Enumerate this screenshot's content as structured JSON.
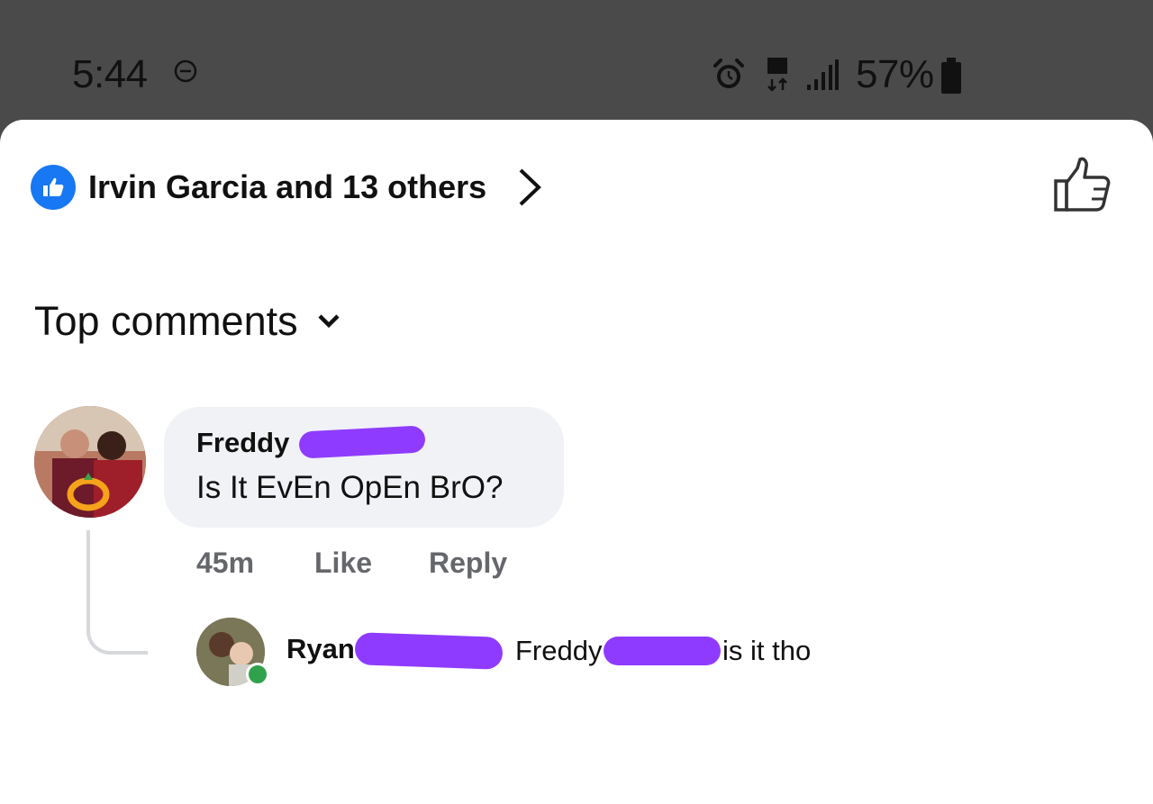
{
  "status_bar": {
    "time": "5:44",
    "battery": "57%",
    "icons": [
      "do-not-disturb-icon",
      "alarm-icon",
      "mobile-data-icon",
      "signal-icon",
      "battery-icon"
    ]
  },
  "reactions": {
    "summary": "Irvin Garcia and 13 others",
    "icon": "like-badge-icon",
    "accent": "#1877f2"
  },
  "sort": {
    "label": "Top comments"
  },
  "comment": {
    "author": "Freddy",
    "text": "Is It EvEn OpEn BrO?",
    "time": "45m",
    "like_label": "Like",
    "reply_label": "Reply"
  },
  "reply": {
    "author": "Ryan",
    "mention": "Freddy",
    "text": "is it tho"
  },
  "colors": {
    "redaction": "#8f3bff",
    "online": "#31a24c",
    "bubble": "#f0f2f5"
  }
}
